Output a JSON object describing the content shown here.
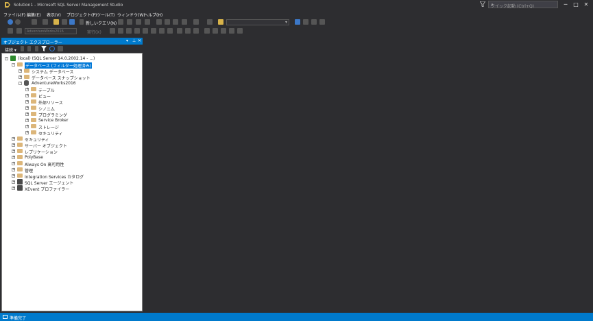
{
  "window": {
    "title": "Solution1 - Microsoft SQL Server Management Studio",
    "quick_launch_placeholder": "クイック起動 (Ctrl+Q)",
    "minimize": "─",
    "maximize": "□",
    "close": "✕"
  },
  "menu": [
    "ファイル(F)",
    "編集(E)",
    "表示(V)",
    "プロジェクト(P)",
    "ツール(T)",
    "ウィンドウ(W)",
    "ヘルプ(H)"
  ],
  "toolbar": {
    "new_query_label": "新しいクエリ(N)",
    "database_combo": "AdventureWorks2016",
    "execute_label": "実行(X)"
  },
  "object_explorer": {
    "title": "オブジェクト エクスプローラー",
    "connect_label": "接続 ▾",
    "tree": [
      {
        "label": "(local) (SQL Server 14.0.2002.14 - ...)",
        "level": 0,
        "expanded": true,
        "icon": "server-icon"
      },
      {
        "label": "データベース (フィルター処理済み)",
        "level": 1,
        "expanded": true,
        "icon": "folder-icon",
        "selected": true
      },
      {
        "label": "システム データベース",
        "level": 2,
        "expanded": false,
        "icon": "folder-icon"
      },
      {
        "label": "データベース スナップショット",
        "level": 2,
        "expanded": false,
        "icon": "folder-icon"
      },
      {
        "label": "AdventureWorks2016",
        "level": 2,
        "expanded": true,
        "icon": "database-icon"
      },
      {
        "label": "テーブル",
        "level": 3,
        "expanded": false,
        "icon": "folder-icon"
      },
      {
        "label": "ビュー",
        "level": 3,
        "expanded": false,
        "icon": "folder-icon"
      },
      {
        "label": "外部リソース",
        "level": 3,
        "expanded": false,
        "icon": "folder-icon"
      },
      {
        "label": "シノニム",
        "level": 3,
        "expanded": false,
        "icon": "folder-icon"
      },
      {
        "label": "プログラミング",
        "level": 3,
        "expanded": false,
        "icon": "folder-icon"
      },
      {
        "label": "Service Broker",
        "level": 3,
        "expanded": false,
        "icon": "folder-icon"
      },
      {
        "label": "ストレージ",
        "level": 3,
        "expanded": false,
        "icon": "folder-icon"
      },
      {
        "label": "セキュリティ",
        "level": 3,
        "expanded": false,
        "icon": "folder-icon"
      },
      {
        "label": "セキュリティ",
        "level": 1,
        "expanded": false,
        "icon": "folder-icon"
      },
      {
        "label": "サーバー オブジェクト",
        "level": 1,
        "expanded": false,
        "icon": "folder-icon"
      },
      {
        "label": "レプリケーション",
        "level": 1,
        "expanded": false,
        "icon": "folder-icon"
      },
      {
        "label": "PolyBase",
        "level": 1,
        "expanded": false,
        "icon": "folder-icon"
      },
      {
        "label": "Always On 高可用性",
        "level": 1,
        "expanded": false,
        "icon": "folder-icon"
      },
      {
        "label": "管理",
        "level": 1,
        "expanded": false,
        "icon": "folder-icon"
      },
      {
        "label": "Integration Services カタログ",
        "level": 1,
        "expanded": false,
        "icon": "folder-icon"
      },
      {
        "label": "SQL Server エージェント",
        "level": 1,
        "expanded": false,
        "icon": "agent-icon"
      },
      {
        "label": "XEvent プロファイラー",
        "level": 1,
        "expanded": false,
        "icon": "xevent-icon"
      }
    ]
  },
  "status": {
    "text": "準備完了"
  },
  "colors": {
    "accent": "#007acc",
    "background": "#2d2d30",
    "folder": "#dcb67a"
  }
}
